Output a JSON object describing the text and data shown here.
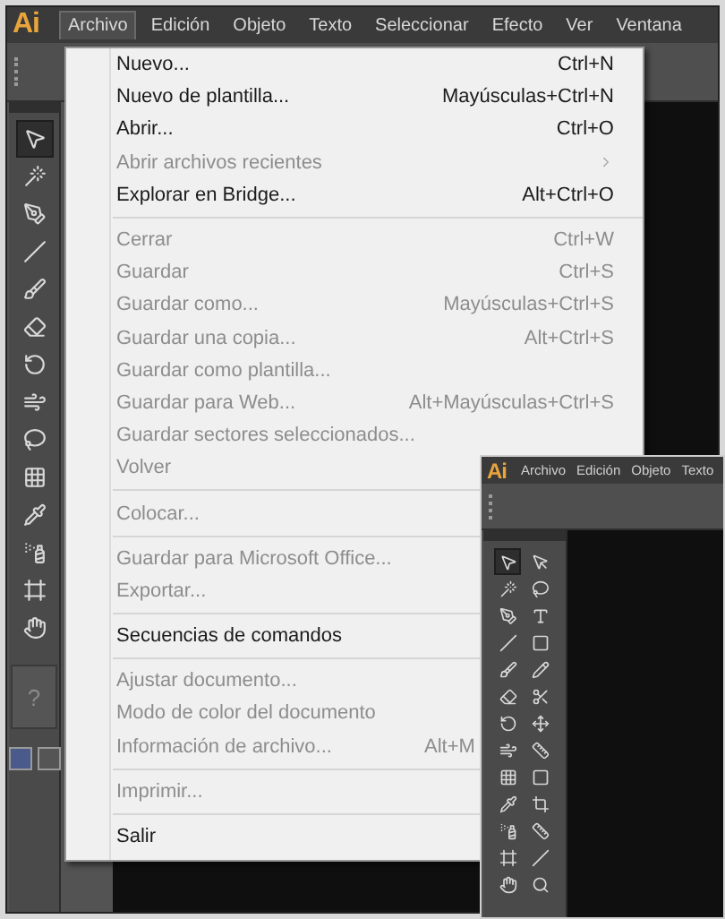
{
  "main_window": {
    "logo": "Ai",
    "menu_bar": [
      {
        "label": "Archivo",
        "selected": true
      },
      {
        "label": "Edición",
        "selected": false
      },
      {
        "label": "Objeto",
        "selected": false
      },
      {
        "label": "Texto",
        "selected": false
      },
      {
        "label": "Seleccionar",
        "selected": false
      },
      {
        "label": "Efecto",
        "selected": false
      },
      {
        "label": "Ver",
        "selected": false
      },
      {
        "label": "Ventana",
        "selected": false
      }
    ],
    "file_menu": [
      {
        "kind": "item",
        "label": "Nuevo...",
        "shortcut": "Ctrl+N",
        "disabled": false
      },
      {
        "kind": "item",
        "label": "Nuevo de plantilla...",
        "shortcut": "Mayúsculas+Ctrl+N",
        "disabled": false
      },
      {
        "kind": "item",
        "label": "Abrir...",
        "shortcut": "Ctrl+O",
        "disabled": false
      },
      {
        "kind": "submenu",
        "label": "Abrir archivos recientes",
        "disabled": true
      },
      {
        "kind": "item",
        "label": "Explorar en Bridge...",
        "shortcut": "Alt+Ctrl+O",
        "disabled": false
      },
      {
        "kind": "separator"
      },
      {
        "kind": "item",
        "label": "Cerrar",
        "shortcut": "Ctrl+W",
        "disabled": true
      },
      {
        "kind": "item",
        "label": "Guardar",
        "shortcut": "Ctrl+S",
        "disabled": true
      },
      {
        "kind": "item",
        "label": "Guardar como...",
        "shortcut": "Mayúsculas+Ctrl+S",
        "disabled": true
      },
      {
        "kind": "item",
        "label": "Guardar una copia...",
        "shortcut": "Alt+Ctrl+S",
        "disabled": true
      },
      {
        "kind": "item",
        "label": "Guardar como plantilla...",
        "disabled": true
      },
      {
        "kind": "item",
        "label": "Guardar para Web...",
        "shortcut": "Alt+Mayúsculas+Ctrl+S",
        "disabled": true
      },
      {
        "kind": "item",
        "label": "Guardar sectores seleccionados...",
        "disabled": true
      },
      {
        "kind": "item",
        "label": "Volver",
        "disabled": true
      },
      {
        "kind": "separator"
      },
      {
        "kind": "item",
        "label": "Colocar...",
        "disabled": true
      },
      {
        "kind": "separator"
      },
      {
        "kind": "item",
        "label": "Guardar para Microsoft Office...",
        "disabled": true
      },
      {
        "kind": "item",
        "label": "Exportar...",
        "disabled": true
      },
      {
        "kind": "separator"
      },
      {
        "kind": "item",
        "label": "Secuencias de comandos",
        "disabled": false
      },
      {
        "kind": "separator"
      },
      {
        "kind": "item",
        "label": "Ajustar documento...",
        "disabled": true
      },
      {
        "kind": "item",
        "label": "Modo de color del documento",
        "disabled": true
      },
      {
        "kind": "clipped",
        "label": "Información de archivo...",
        "shortcut": "Alt+M",
        "disabled": true
      },
      {
        "kind": "separator"
      },
      {
        "kind": "item",
        "label": "Imprimir...",
        "disabled": true
      },
      {
        "kind": "separator"
      },
      {
        "kind": "item",
        "label": "Salir",
        "disabled": false
      }
    ],
    "toolbar": {
      "help_label": "?"
    }
  },
  "second_window": {
    "logo": "Ai",
    "menu_bar": [
      "Archivo",
      "Edición",
      "Objeto",
      "Texto"
    ]
  }
}
